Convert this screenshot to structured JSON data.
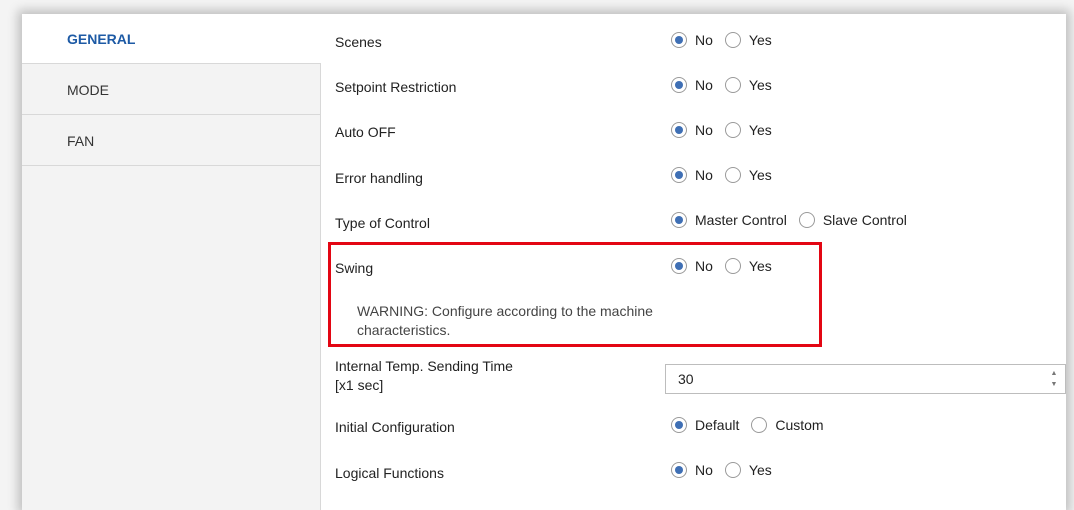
{
  "sidebar": {
    "items": [
      {
        "label": "GENERAL",
        "active": true
      },
      {
        "label": "MODE",
        "active": false
      },
      {
        "label": "FAN",
        "active": false
      }
    ]
  },
  "rows": {
    "scenes": {
      "label": "Scenes",
      "opt1": "No",
      "opt2": "Yes",
      "selected": "No"
    },
    "setpoint": {
      "label": "Setpoint Restriction",
      "opt1": "No",
      "opt2": "Yes",
      "selected": "No"
    },
    "autooff": {
      "label": "Auto OFF",
      "opt1": "No",
      "opt2": "Yes",
      "selected": "No"
    },
    "error": {
      "label": "Error handling",
      "opt1": "No",
      "opt2": "Yes",
      "selected": "No"
    },
    "control": {
      "label": "Type of Control",
      "opt1": "Master Control",
      "opt2": "Slave Control",
      "selected": "Master Control"
    },
    "swing": {
      "label": "Swing",
      "opt1": "No",
      "opt2": "Yes",
      "selected": "No",
      "warning": "WARNING: Configure according to the machine characteristics."
    },
    "temp": {
      "label_line1": "Internal Temp. Sending Time",
      "label_line2": "[x1 sec]",
      "value": "30"
    },
    "initial": {
      "label": "Initial Configuration",
      "opt1": "Default",
      "opt2": "Custom",
      "selected": "Default"
    },
    "logical": {
      "label": "Logical Functions",
      "opt1": "No",
      "opt2": "Yes",
      "selected": "No"
    }
  },
  "colors": {
    "accent": "#1d5aa5",
    "radio_fill": "#3f6fb4",
    "highlight_border": "#e30613"
  }
}
